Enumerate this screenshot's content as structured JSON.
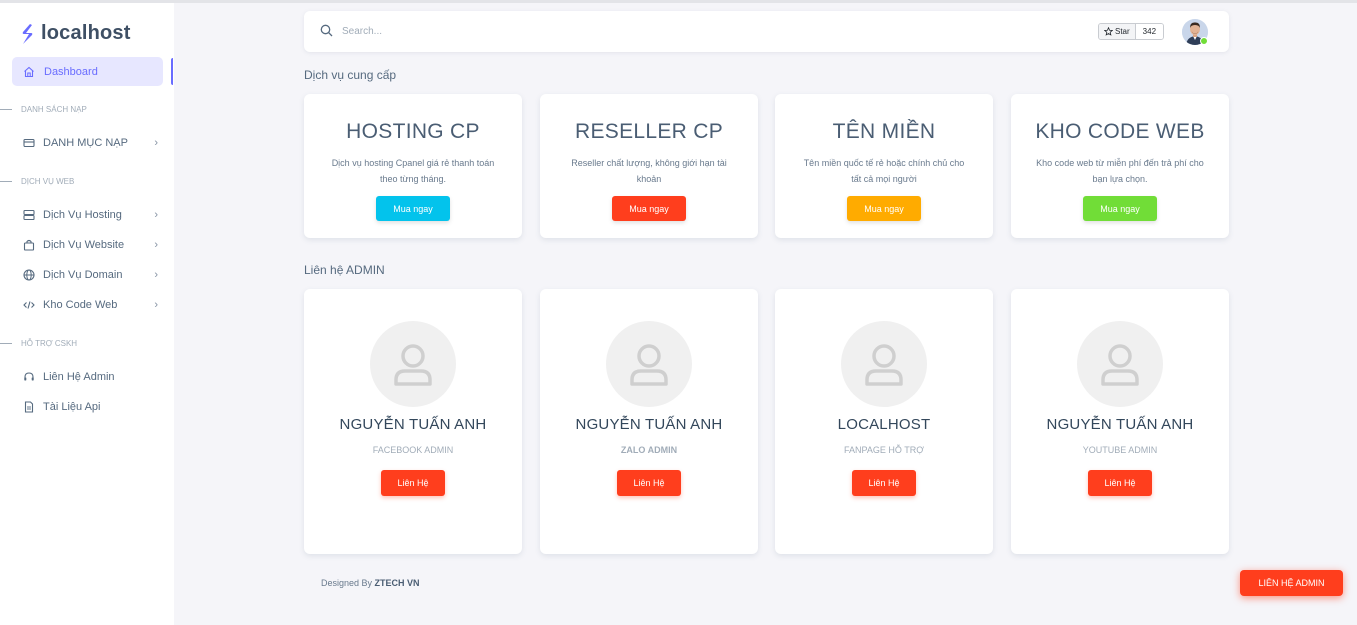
{
  "brand": {
    "name": "localhost"
  },
  "sidebar": {
    "active": {
      "label": "Dashboard",
      "icon": "home-icon"
    },
    "sections": [
      {
        "header": "DANH SÁCH NẠP",
        "items": [
          {
            "label": "DANH MỤC NẠP",
            "icon": "credit-card-icon"
          }
        ]
      },
      {
        "header": "DỊCH VỤ WEB",
        "items": [
          {
            "label": "Dịch Vụ Hosting",
            "icon": "server-icon"
          },
          {
            "label": "Dịch Vụ Website",
            "icon": "shopping-bag-icon"
          },
          {
            "label": "Dịch Vụ Domain",
            "icon": "globe-icon"
          },
          {
            "label": "Kho Code Web",
            "icon": "code-icon"
          }
        ]
      },
      {
        "header": "HỖ TRỢ CSKH",
        "items": [
          {
            "label": "Liên Hệ Admin",
            "icon": "headset-icon"
          },
          {
            "label": "Tài Liệu Api",
            "icon": "document-icon"
          }
        ]
      }
    ]
  },
  "navbar": {
    "search_placeholder": "Search...",
    "github": {
      "star_label": "Star",
      "count": "342"
    }
  },
  "services": {
    "title": "Dịch vụ cung cấp",
    "cards": [
      {
        "title": "HOSTING CP",
        "description": "Dịch vụ hosting Cpanel giá rẻ thanh toán theo từng tháng.",
        "button": "Mua ngay",
        "color": "#03c3ec"
      },
      {
        "title": "RESELLER CP",
        "description": "Reseller chất lượng, không giới hạn tài khoản",
        "button": "Mua ngay",
        "color": "#ff3e1d"
      },
      {
        "title": "TÊN MIỀN",
        "description": "Tên miền quốc tế rẻ hoặc chính chủ cho tất cả mọi người",
        "button": "Mua ngay",
        "color": "#ffab00"
      },
      {
        "title": "KHO CODE WEB",
        "description": "Kho code web từ miễn phí đến trả phí cho bạn lựa chọn.",
        "button": "Mua ngay",
        "color": "#71dd37"
      }
    ]
  },
  "contacts": {
    "title": "Liên hệ ADMIN",
    "cards": [
      {
        "name": "NGUYỄN TUẤN ANH",
        "role": "FACEBOOK ADMIN",
        "button": "Liên Hệ"
      },
      {
        "name": "NGUYỄN TUẤN ANH",
        "role": "ZALO ADMIN",
        "button": "Liên Hệ"
      },
      {
        "name": "LOCALHOST",
        "role": "FANPAGE HỖ TRỢ",
        "button": "Liên Hệ"
      },
      {
        "name": "NGUYỄN TUẤN ANH",
        "role": "YOUTUBE ADMIN",
        "button": "Liên Hệ"
      }
    ]
  },
  "footer": {
    "prefix": "Designed By",
    "company": "ZTECH VN"
  },
  "fab": {
    "label": "LIÊN HỆ ADMIN"
  }
}
